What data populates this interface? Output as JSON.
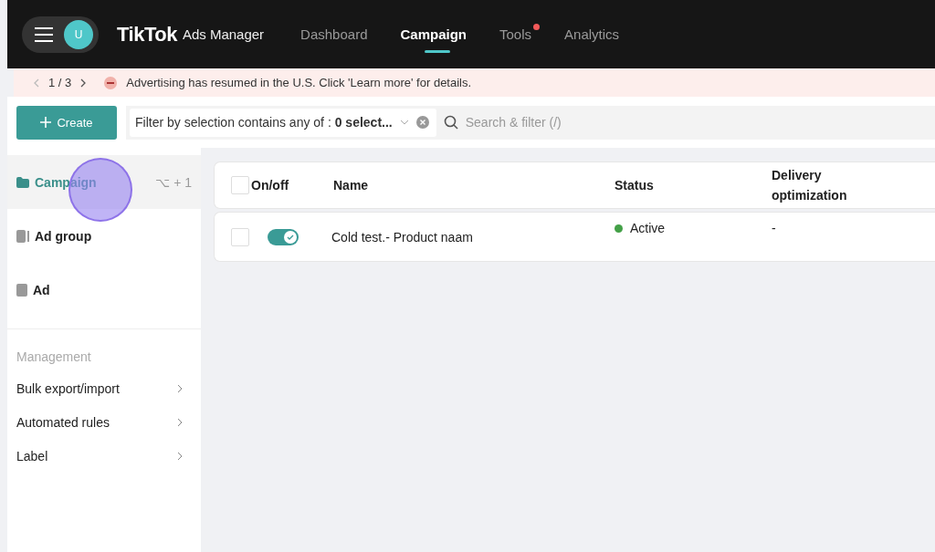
{
  "header": {
    "avatar": "U",
    "logo": "TikTok",
    "logo_suffix": "Ads Manager",
    "nav": [
      {
        "label": "Dashboard",
        "selected": false,
        "dot": false
      },
      {
        "label": "Campaign",
        "selected": true,
        "dot": false
      },
      {
        "label": "Tools",
        "selected": false,
        "dot": true
      },
      {
        "label": "Analytics",
        "selected": false,
        "dot": false
      }
    ]
  },
  "banner": {
    "pager": "1 / 3",
    "message": "Advertising has resumed in the U.S. Click 'Learn more' for details."
  },
  "toolbar": {
    "create": "Create",
    "filter_label": "Filter by selection contains any of : ",
    "filter_value": "0 select...",
    "search_placeholder": "Search & filter (/)"
  },
  "sidebar": {
    "items": [
      {
        "label": "Campaign",
        "selected": true,
        "shortcut": "⌥ + 1",
        "kind": "folder"
      },
      {
        "label": "Ad group",
        "selected": false,
        "kind": "group"
      },
      {
        "label": "Ad",
        "selected": false,
        "kind": "ad"
      }
    ],
    "section": "Management",
    "links": [
      "Bulk export/import",
      "Automated rules",
      "Label"
    ]
  },
  "table": {
    "all_checked": false,
    "columns": [
      "On/off",
      "Name",
      "Status",
      "Delivery optimization"
    ],
    "rows": [
      {
        "checked": false,
        "on": true,
        "name": "Cold test.- Product naam",
        "status": "Active",
        "color": "#43a047",
        "delivery": "-"
      }
    ]
  }
}
